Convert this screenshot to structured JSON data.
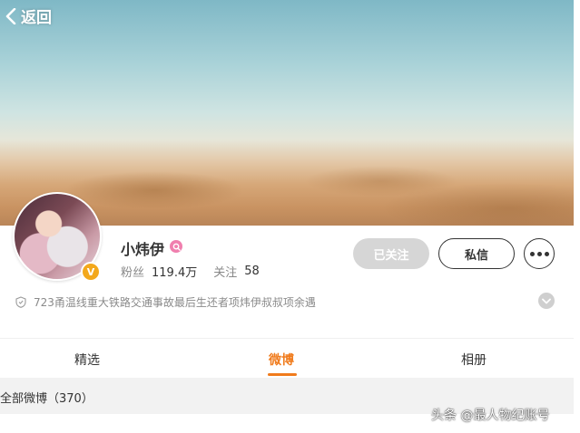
{
  "nav": {
    "back_label": "返回"
  },
  "profile": {
    "name": "小炜伊",
    "verified_badge": "V",
    "fans_label": "粉丝",
    "fans_count": "119.4万",
    "following_label": "关注",
    "following_count": "58",
    "bio": "723甬温线重大铁路交通事故最后生还者项炜伊叔叔项余遇"
  },
  "actions": {
    "followed_label": "已关注",
    "message_label": "私信"
  },
  "tabs": [
    {
      "label": "精选",
      "active": false
    },
    {
      "label": "微博",
      "active": true
    },
    {
      "label": "相册",
      "active": false
    }
  ],
  "list": {
    "header": "全部微博（370）"
  },
  "watermark": "头条 @最人物纪账号",
  "colors": {
    "accent": "#f07b1c",
    "verified": "#f3a81c",
    "member": "#f07fae",
    "followed_button": "#d6d6d6"
  },
  "icons": [
    "back-chevron-icon",
    "member-icon",
    "verified-badge-icon",
    "shield-icon",
    "expand-chevron-icon",
    "more-dots-icon"
  ]
}
